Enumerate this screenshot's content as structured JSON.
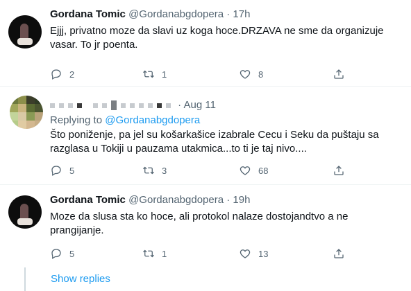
{
  "tweets": [
    {
      "name": "Gordana Tomic",
      "handle": "@Gordanabgdopera",
      "time": "17h",
      "text": "Ejjj, privatno moze da slavi uz koga hoce.DRZAVA ne sme da organizuje vasar. To jr poenta.",
      "replies": "2",
      "retweets": "1",
      "likes": "8"
    },
    {
      "time": "Aug 11",
      "replying_label": "Replying to",
      "replying_to": "@Gordanabgdopera",
      "text": "Što poniženje, pa jel su košarkašice izabrale Cecu i Seku da puštaju sa razglasa u Tokiji u pauzama utakmica...to ti je taj nivo....",
      "replies": "5",
      "retweets": "3",
      "likes": "68"
    },
    {
      "name": "Gordana Tomic",
      "handle": "@Gordanabgdopera",
      "time": "19h",
      "text": "Moze da slusa sta ko hoce, ali protokol nalaze dostojandtvo a ne prangijanje.",
      "replies": "5",
      "retweets": "1",
      "likes": "13"
    }
  ],
  "separator": "·",
  "show_replies": "Show replies",
  "colors": {
    "link": "#1d9bf0",
    "secondary_text": "#536471",
    "primary_text": "#0f1419"
  },
  "icons": [
    "reply-icon",
    "retweet-icon",
    "like-icon",
    "share-icon"
  ]
}
